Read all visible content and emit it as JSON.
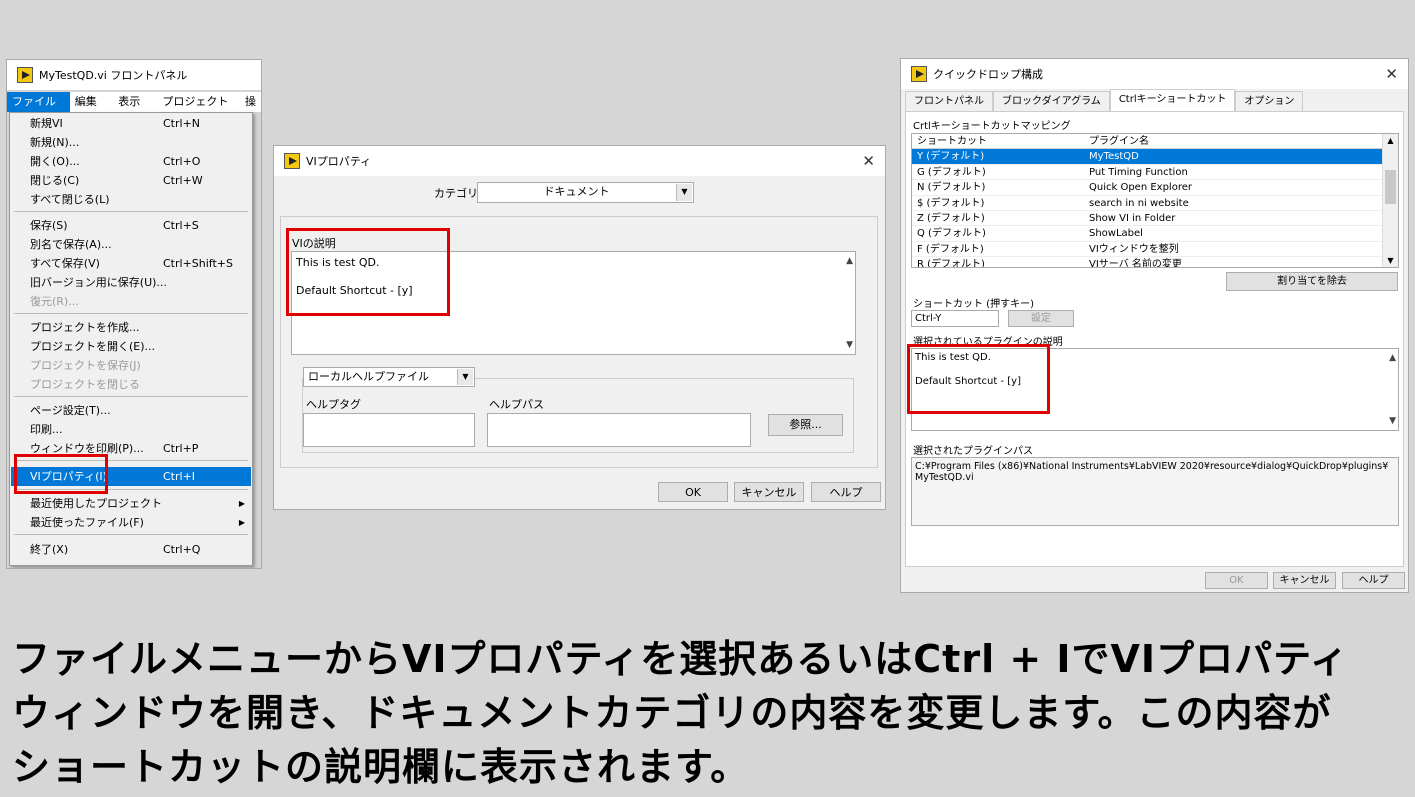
{
  "w1": {
    "title": "MyTestQD.vi フロントパネル",
    "menubar": [
      "ファイル(F)",
      "編集(E)",
      "表示(V)",
      "プロジェクト(P)",
      "操"
    ],
    "menu_items": [
      {
        "label": "新規VI",
        "shortcut": "Ctrl+N"
      },
      {
        "label": "新規(N)...",
        "shortcut": ""
      },
      {
        "label": "開く(O)...",
        "shortcut": "Ctrl+O"
      },
      {
        "label": "閉じる(C)",
        "shortcut": "Ctrl+W"
      },
      {
        "label": "すべて閉じる(L)",
        "shortcut": ""
      },
      {
        "label": "保存(S)",
        "shortcut": "Ctrl+S"
      },
      {
        "label": "別名で保存(A)...",
        "shortcut": ""
      },
      {
        "label": "すべて保存(V)",
        "shortcut": "Ctrl+Shift+S"
      },
      {
        "label": "旧バージョン用に保存(U)...",
        "shortcut": ""
      },
      {
        "label": "復元(R)...",
        "shortcut": ""
      },
      {
        "label": "プロジェクトを作成...",
        "shortcut": ""
      },
      {
        "label": "プロジェクトを開く(E)...",
        "shortcut": ""
      },
      {
        "label": "プロジェクトを保存(J)",
        "shortcut": ""
      },
      {
        "label": "プロジェクトを閉じる",
        "shortcut": ""
      },
      {
        "label": "ページ設定(T)...",
        "shortcut": ""
      },
      {
        "label": "印刷...",
        "shortcut": ""
      },
      {
        "label": "ウィンドウを印刷(P)...",
        "shortcut": "Ctrl+P"
      },
      {
        "label": "VIプロパティ(I)",
        "shortcut": "Ctrl+I"
      },
      {
        "label": "最近使用したプロジェクト",
        "shortcut": ""
      },
      {
        "label": "最近使ったファイル(F)",
        "shortcut": ""
      },
      {
        "label": "終了(X)",
        "shortcut": "Ctrl+Q"
      }
    ]
  },
  "w2": {
    "title": "VIプロパティ",
    "category_label": "カテゴリ",
    "category_value": "ドキュメント",
    "desc_label": "VIの説明",
    "desc_line1": "This is test QD.",
    "desc_line2": "Default Shortcut - [y]",
    "help_file": "ローカルヘルプファイル",
    "help_tag_label": "ヘルプタグ",
    "help_path_label": "ヘルプパス",
    "browse_button": "参照...",
    "ok": "OK",
    "cancel": "キャンセル",
    "help": "ヘルプ"
  },
  "w3": {
    "title": "クイックドロップ構成",
    "tabs": [
      "フロントパネル",
      "ブロックダイアグラム",
      "Ctrlキーショートカット",
      "オプション"
    ],
    "mapping_label": "Crtlキーショートカットマッピング",
    "col_shortcut": "ショートカット",
    "col_plugin": "プラグイン名",
    "rows": [
      {
        "shortcut": "Y (デフォルト)",
        "plugin": "MyTestQD"
      },
      {
        "shortcut": "G (デフォルト)",
        "plugin": "Put Timing Function"
      },
      {
        "shortcut": "N (デフォルト)",
        "plugin": "Quick Open Explorer"
      },
      {
        "shortcut": "$ (デフォルト)",
        "plugin": "search in ni website"
      },
      {
        "shortcut": "Z (デフォルト)",
        "plugin": "Show VI in Folder"
      },
      {
        "shortcut": "Q (デフォルト)",
        "plugin": "ShowLabel"
      },
      {
        "shortcut": "F (デフォルト)",
        "plugin": "VIウィンドウを整列"
      },
      {
        "shortcut": "R (デフォルト)",
        "plugin": "VIサーバ 名前の変更"
      }
    ],
    "remove_button": "割り当てを除去",
    "shortcut_label": "ショートカット (押すキー)",
    "shortcut_value": "Ctrl-Y",
    "set_button": "設定",
    "plugin_desc_label": "選択されているプラグインの説明",
    "desc_line1": "This is test QD.",
    "desc_line2": "Default Shortcut - [y]",
    "path_label": "選択されたプラグインパス",
    "path_line1": "C:¥Program Files (x86)¥National Instruments¥LabVIEW 2020¥resource¥dialog¥QuickDrop¥plugins¥",
    "path_line2": "MyTestQD.vi",
    "ok": "OK",
    "cancel": "キャンセル",
    "help": "ヘルプ"
  },
  "caption": {
    "line1": "ファイルメニューからVIプロパティを選択あるいはCtrl + IでVIプロパティ",
    "line2": "ウィンドウを開き、ドキュメントカテゴリの内容を変更します。この内容が",
    "line3": "ショートカットの説明欄に表示されます。"
  }
}
